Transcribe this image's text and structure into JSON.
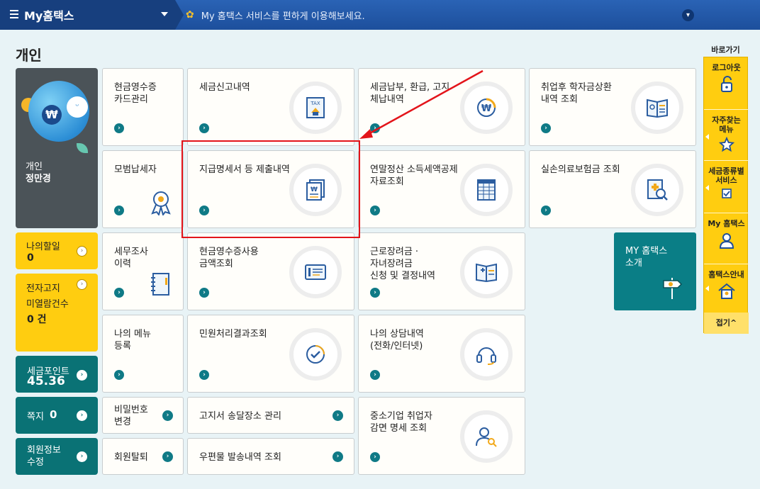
{
  "topbar": {
    "menu_label": "My홈택스",
    "notice": "My 홈택스 서비스를 편하게 이용해보세요."
  },
  "page_title": "개인",
  "profile": {
    "type": "개인",
    "name": "정만경"
  },
  "left": {
    "todo_label": "나의할일",
    "todo_value": "0",
    "ebill_label1": "전자고지",
    "ebill_label2": "미열람건수",
    "ebill_value": "0 건",
    "points_label": "세금포인트",
    "points_value": "45.36",
    "notes_label": "쪽지",
    "notes_value": "0",
    "member_label": "회원정보\n수정"
  },
  "cards": {
    "c1": "현금영수증\n카드관리",
    "c2": "세금신고내역",
    "c3": "세금납부, 환급, 고지\n체납내역",
    "c4": "취업후 학자금상환\n내역 조회",
    "c5": "모범납세자",
    "c6": "지급명세서 등 제출내역",
    "c7": "연말정산 소득세액공제\n자료조회",
    "c8": "실손의료보험금 조회",
    "c9": "세무조사\n이력",
    "c10": "현금영수증사용\n금액조회",
    "c11": "근로장려금 ·\n자녀장려금\n신청 및 결정내역",
    "c12": "나의 메뉴\n등록",
    "c13": "민원처리결과조회",
    "c14": "나의 상담내역\n(전화/인터넷)",
    "c15": "비밀번호\n변경",
    "c16": "고지서 송달장소 관리",
    "c17": "중소기업 취업자\n감면 명세 조회",
    "c18": "회원탈퇴",
    "c19": "우편물 발송내역 조회",
    "my_intro": "MY 홈택스\n소개"
  },
  "quick": {
    "title": "바로가기",
    "logout": "로그아웃",
    "faq": "자주찾는\n메뉴",
    "tax_service": "세금종류별\n서비스",
    "my_hometax": "My 홈택스",
    "guide": "홈택스안내",
    "fold": "접기^"
  }
}
